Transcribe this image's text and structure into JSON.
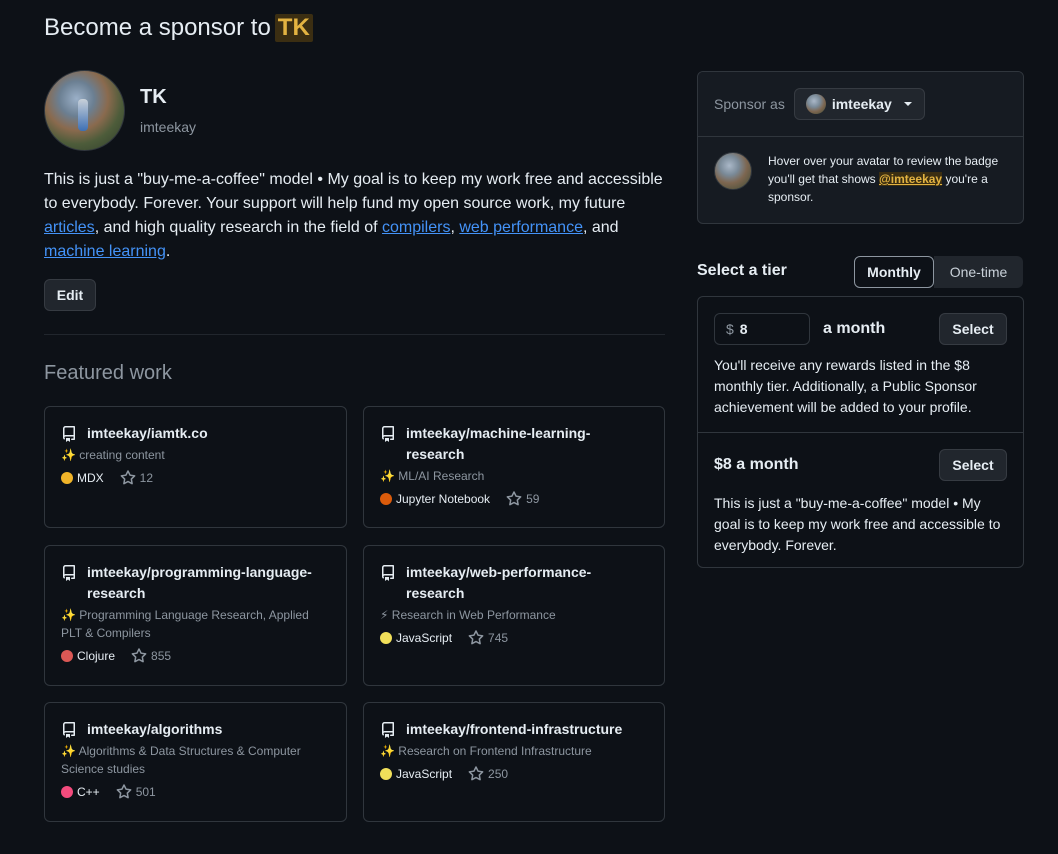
{
  "header": {
    "title_prefix": "Become a sponsor to",
    "title_highlight": "TK"
  },
  "profile": {
    "name": "TK",
    "login": "imteekay",
    "bio": {
      "part1": "This is just a \"buy-me-a-coffee\" model • My goal is to keep my work free and accessible to everybody. Forever. Your support will help fund my open source work, my future ",
      "link_articles": "articles",
      "part2": ", and high quality research in the field of ",
      "link_compilers": "compilers",
      "sep1": ", ",
      "link_webperf": "web performance",
      "sep2": ", and ",
      "link_ml": "machine learning",
      "end": "."
    },
    "edit_label": "Edit"
  },
  "featured": {
    "title": "Featured work",
    "repos": [
      {
        "name": "imteekay/iamtk.co",
        "emoji": "✨",
        "desc": "creating content",
        "lang": "MDX",
        "lang_color": "#f0b429",
        "stars": "12"
      },
      {
        "name": "imteekay/machine-learning-research",
        "emoji": "✨",
        "desc": "ML/AI Research",
        "lang": "Jupyter Notebook",
        "lang_color": "#DA5B0B",
        "stars": "59"
      },
      {
        "name": "imteekay/programming-language-research",
        "emoji": "✨",
        "desc": "Programming Language Research, Applied PLT & Compilers",
        "lang": "Clojure",
        "lang_color": "#db5855",
        "stars": "855"
      },
      {
        "name": "imteekay/web-performance-research",
        "emoji": "⚡",
        "desc": "Research in Web Performance",
        "lang": "JavaScript",
        "lang_color": "#f1e05a",
        "stars": "745"
      },
      {
        "name": "imteekay/algorithms",
        "emoji": "✨",
        "desc": "Algorithms & Data Structures & Computer Science studies",
        "lang": "C++",
        "lang_color": "#f34b7d",
        "stars": "501"
      },
      {
        "name": "imteekay/frontend-infrastructure",
        "emoji": "✨",
        "desc": "Research on Frontend Infrastructure",
        "lang": "JavaScript",
        "lang_color": "#f1e05a",
        "stars": "250"
      }
    ]
  },
  "sponsor": {
    "label": "Sponsor as",
    "account": "imteekay",
    "hover_text1": "Hover over your avatar to review the badge you'll get that shows ",
    "hover_mention": "@imteekay",
    "hover_text2": " you're a sponsor."
  },
  "tiers": {
    "title": "Select a tier",
    "toggle_monthly": "Monthly",
    "toggle_onetime": "One-time",
    "custom": {
      "currency": "$",
      "amount": "8",
      "period": "a month",
      "select_label": "Select",
      "desc": "You'll receive any rewards listed in the $8 monthly tier. Additionally, a Public Sponsor achievement will be added to your profile."
    },
    "fixed": {
      "name": "$8 a month",
      "select_label": "Select",
      "desc": "This is just a \"buy-me-a-coffee\" model • My goal is to keep my work free and accessible to everybody. Forever."
    }
  },
  "colors": {
    "accent": "#4493f8",
    "highlight_bg": "#3b2e12",
    "highlight_fg": "#e3b341"
  },
  "icons": {
    "repo": "repo-icon",
    "star": "star-icon",
    "caret": "caret-down-icon"
  }
}
